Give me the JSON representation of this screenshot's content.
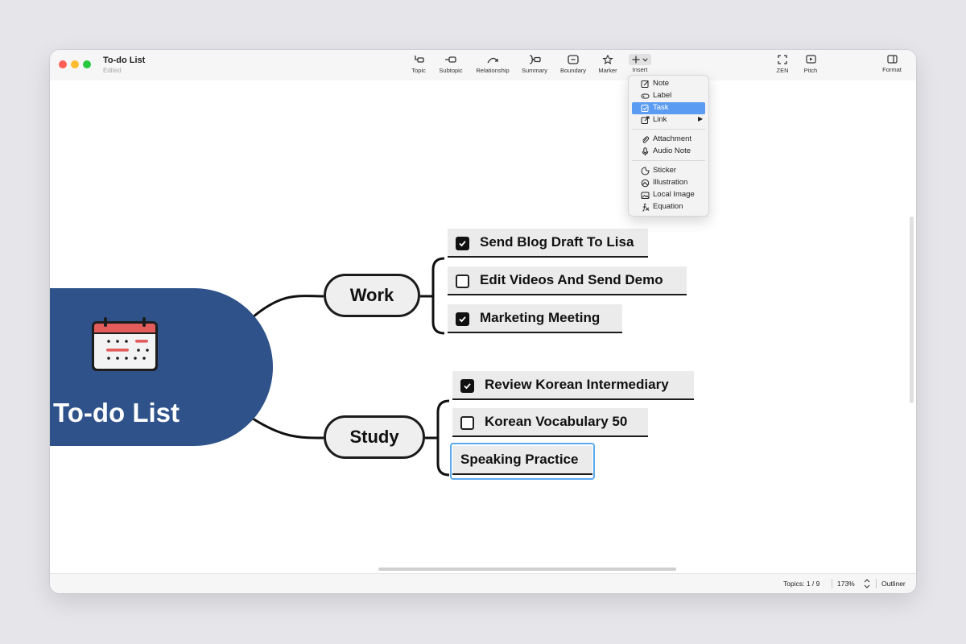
{
  "window": {
    "title": "To-do List",
    "subtitle": "Edited"
  },
  "toolbar": {
    "topic": "Topic",
    "subtopic": "Subtopic",
    "relationship": "Relationship",
    "summary": "Summary",
    "boundary": "Boundary",
    "marker": "Marker",
    "insert": "Insert",
    "zen": "ZEN",
    "pitch": "Pitch",
    "format": "Format"
  },
  "insert_menu": {
    "items": [
      {
        "label": "Note",
        "icon": "note-icon"
      },
      {
        "label": "Label",
        "icon": "label-icon"
      },
      {
        "label": "Task",
        "icon": "task-icon",
        "highlighted": true
      },
      {
        "label": "Link",
        "icon": "link-icon",
        "submenu": "▶"
      },
      {
        "label": "Attachment",
        "icon": "attachment-icon"
      },
      {
        "label": "Audio Note",
        "icon": "microphone-icon"
      },
      {
        "label": "Sticker",
        "icon": "sticker-icon"
      },
      {
        "label": "Illustration",
        "icon": "illustration-icon"
      },
      {
        "label": "Local Image",
        "icon": "image-icon"
      },
      {
        "label": "Equation",
        "icon": "equation-icon"
      }
    ]
  },
  "mindmap": {
    "central_topic": "To-do List",
    "branches": [
      {
        "label": "Work",
        "tasks": [
          {
            "label": "Send Blog Draft To Lisa",
            "checked": true
          },
          {
            "label": "Edit Videos And Send Demo",
            "checked": false
          },
          {
            "label": "Marketing Meeting",
            "checked": true
          }
        ]
      },
      {
        "label": "Study",
        "tasks": [
          {
            "label": "Review Korean Intermediary",
            "checked": true
          },
          {
            "label": "Korean Vocabulary 50",
            "checked": false
          },
          {
            "label": "Speaking Practice",
            "checked": null,
            "selected": true
          }
        ]
      }
    ]
  },
  "statusbar": {
    "topics": "Topics: 1 / 9",
    "zoom": "173%",
    "zoom_stepper": "⌃⌄",
    "view": "Outliner"
  },
  "colors": {
    "central_topic": "#2e5289",
    "menu_highlight": "#5b9cf2",
    "selection_ring": "#5aa9f0"
  }
}
